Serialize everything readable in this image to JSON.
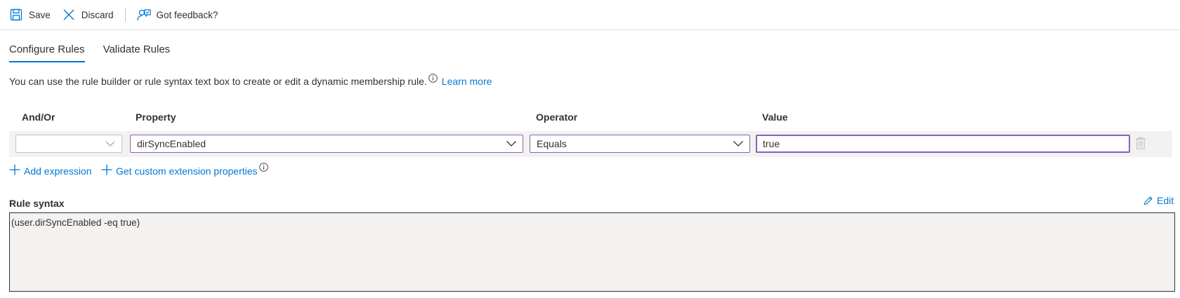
{
  "toolbar": {
    "save_label": "Save",
    "discard_label": "Discard",
    "feedback_label": "Got feedback?"
  },
  "tabs": [
    {
      "label": "Configure Rules",
      "active": true
    },
    {
      "label": "Validate Rules",
      "active": false
    }
  ],
  "description": {
    "text": "You can use the rule builder or rule syntax text box to create or edit a dynamic membership rule.",
    "learn_more": "Learn more"
  },
  "grid": {
    "headers": {
      "and_or": "And/Or",
      "property": "Property",
      "operator": "Operator",
      "value": "Value"
    },
    "row": {
      "and_or": "",
      "property": "dirSyncEnabled",
      "operator": "Equals",
      "value": "true"
    }
  },
  "actions": {
    "add_expression": "Add expression",
    "get_custom_extension": "Get custom extension properties"
  },
  "rule_syntax": {
    "title": "Rule syntax",
    "edit_label": "Edit",
    "value": "(user.dirSyncEnabled -eq true)"
  },
  "colors": {
    "accent": "#0078d4",
    "focus_border": "#8764b8",
    "row_bg": "#f3f2f1"
  }
}
